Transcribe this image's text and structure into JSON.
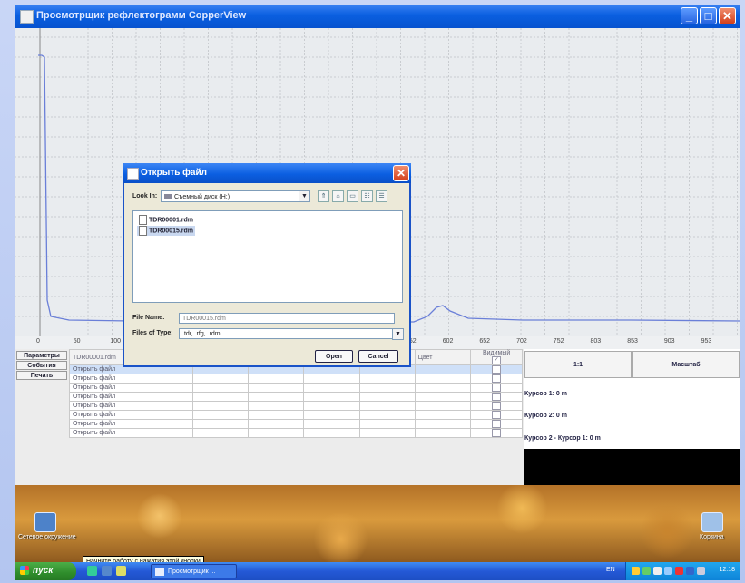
{
  "window": {
    "title": "Просмотрщик рефлектограмм CopperView",
    "controls": {
      "minimize": "_",
      "maximize": "□",
      "close": "✕"
    }
  },
  "plot": {
    "x_ticks": [
      "0",
      "50",
      "100",
      "",
      "",
      "",
      "",
      "",
      "",
      "",
      "552",
      "602",
      "652",
      "702",
      "752",
      "803",
      "853",
      "903",
      "953"
    ]
  },
  "side_buttons": [
    "Параметры",
    "События",
    "Печать"
  ],
  "table": {
    "headers": [
      "TDR00001.rdm",
      "",
      "",
      "",
      "",
      "Цвет",
      "Видимый"
    ],
    "rows": [
      {
        "name": "Открыть файл",
        "visible": false,
        "selected": true
      },
      {
        "name": "Открыть файл",
        "visible": false,
        "selected": false
      },
      {
        "name": "Открыть файл",
        "visible": false,
        "selected": false
      },
      {
        "name": "Открыть файл",
        "visible": false,
        "selected": false
      },
      {
        "name": "Открыть файл",
        "visible": false,
        "selected": false
      },
      {
        "name": "Открыть файл",
        "visible": false,
        "selected": false
      },
      {
        "name": "Открыть файл",
        "visible": false,
        "selected": false
      },
      {
        "name": "Открыть файл",
        "visible": false,
        "selected": false
      }
    ],
    "header_checkbox": "✓"
  },
  "right_panel": {
    "btn_1to1": "1:1",
    "btn_scale": "Масштаб",
    "cursor1": "Курсор 1: 0 m",
    "cursor2": "Курсор 2: 0 m",
    "cursor_diff": "Курсор 2 - Курсор 1: 0 m"
  },
  "dialog": {
    "title": "Открыть файл",
    "look_in_label": "Look In:",
    "look_in_value": "Съемный диск (H:)",
    "files": [
      "TDR00001.rdm",
      "TDR00015.rdm"
    ],
    "selected_file_index": 1,
    "file_name_label": "File Name:",
    "file_name_value": "TDR00015.rdm",
    "files_of_type_label": "Files of Type:",
    "files_of_type_value": ".tdr, .rfg, .rdm",
    "open": "Open",
    "cancel": "Cancel"
  },
  "desktop": {
    "icon1_label": "Сетевое окружение",
    "icon2_label": "Корзина",
    "tooltip": "Начните работу с нажатия этой кнопки"
  },
  "taskbar": {
    "start": "пуск",
    "task_item": "Просмотрщик ...",
    "lang": "EN",
    "clock": "12:18"
  },
  "colors": {
    "trace": "#6a7fd8",
    "titlebar": "#0a5fe0",
    "start": "#2f8d2c"
  }
}
